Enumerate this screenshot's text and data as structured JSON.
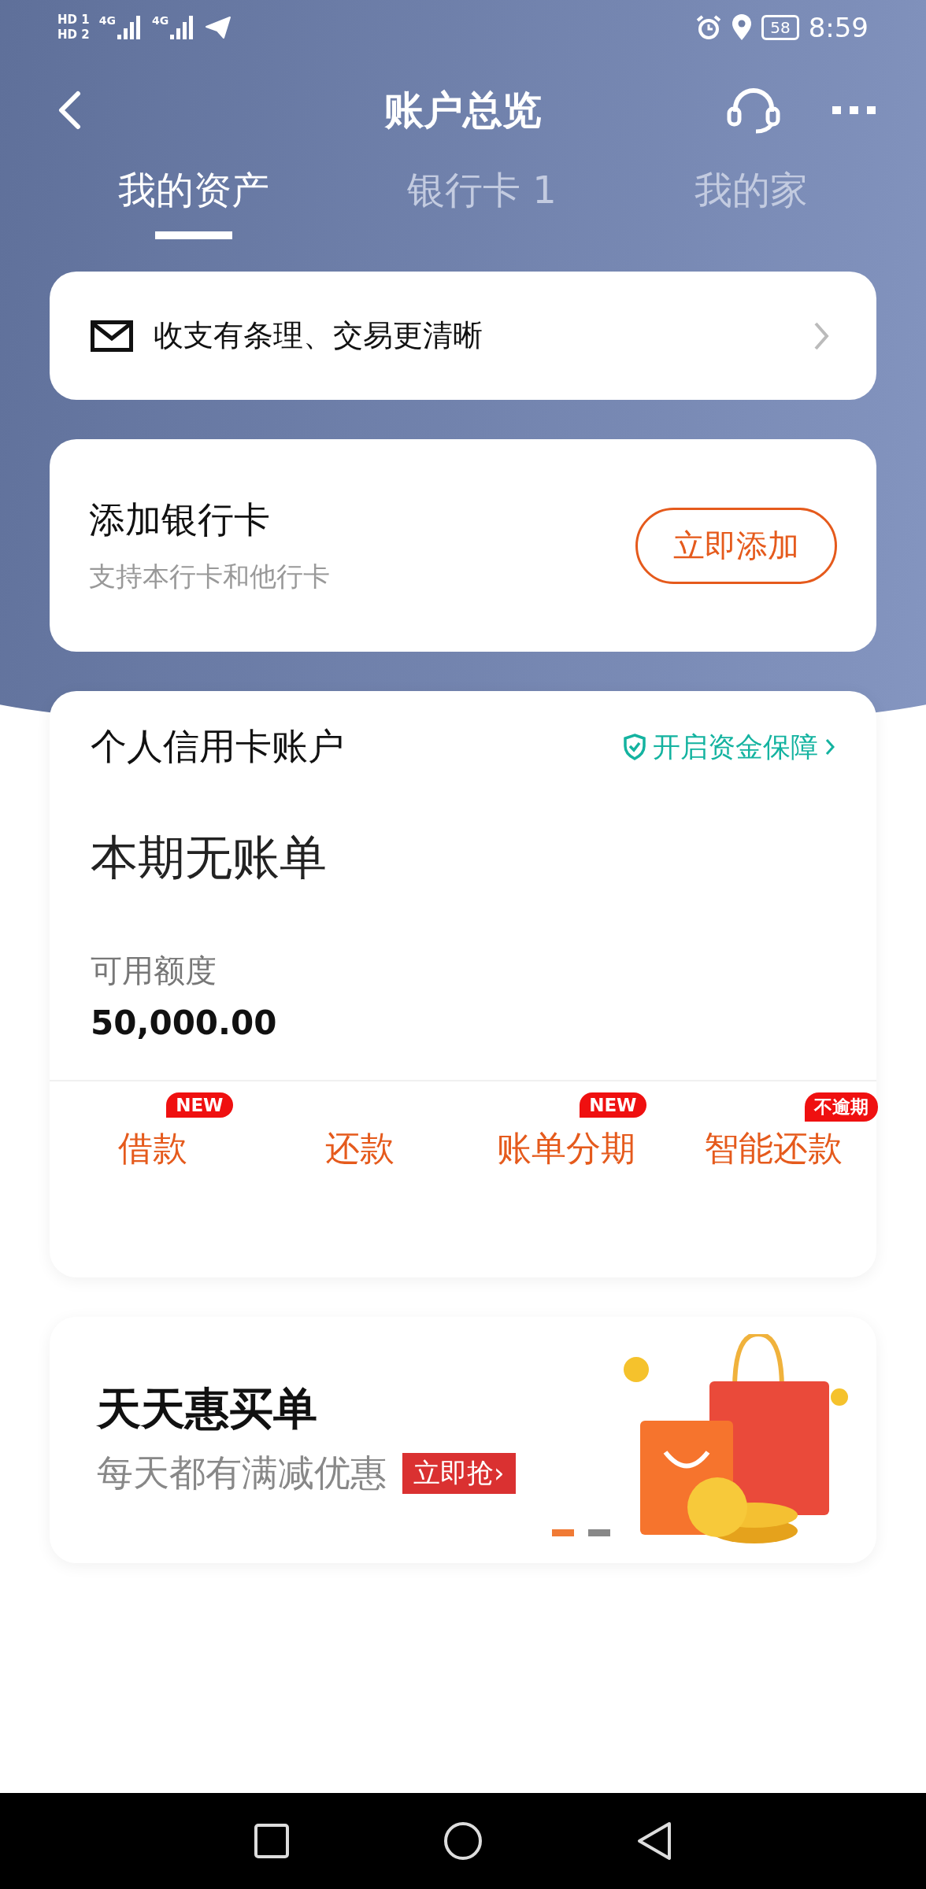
{
  "status_bar": {
    "sim_labels": [
      "HD 1",
      "HD 2"
    ],
    "network_labels": [
      "4G",
      "4G"
    ],
    "battery": "58",
    "time": "8:59"
  },
  "header": {
    "title": "账户总览"
  },
  "tabs": [
    {
      "label": "我的资产",
      "selected": true
    },
    {
      "label": "银行卡 1",
      "selected": false
    },
    {
      "label": "我的家",
      "selected": false
    }
  ],
  "notice_card": {
    "text": "收支有条理、交易更清晰"
  },
  "add_card": {
    "title": "添加银行卡",
    "subtitle": "支持本行卡和他行卡",
    "button": "立即添加"
  },
  "credit_account": {
    "title": "个人信用卡账户",
    "protection_link": "开启资金保障",
    "bill_status": "本期无账单",
    "limit_label": "可用额度",
    "limit_value": "50,000.00",
    "actions": [
      {
        "label": "借款",
        "badge": "NEW"
      },
      {
        "label": "还款"
      },
      {
        "label": "账单分期",
        "badge": "NEW"
      },
      {
        "label": "智能还款",
        "badge": "不逾期"
      }
    ]
  },
  "banner": {
    "title": "天天惠买单",
    "subtitle": "每天都有满减优惠",
    "button": "立即抢›",
    "dots": [
      {
        "selected": true
      },
      {
        "selected": false
      }
    ]
  }
}
